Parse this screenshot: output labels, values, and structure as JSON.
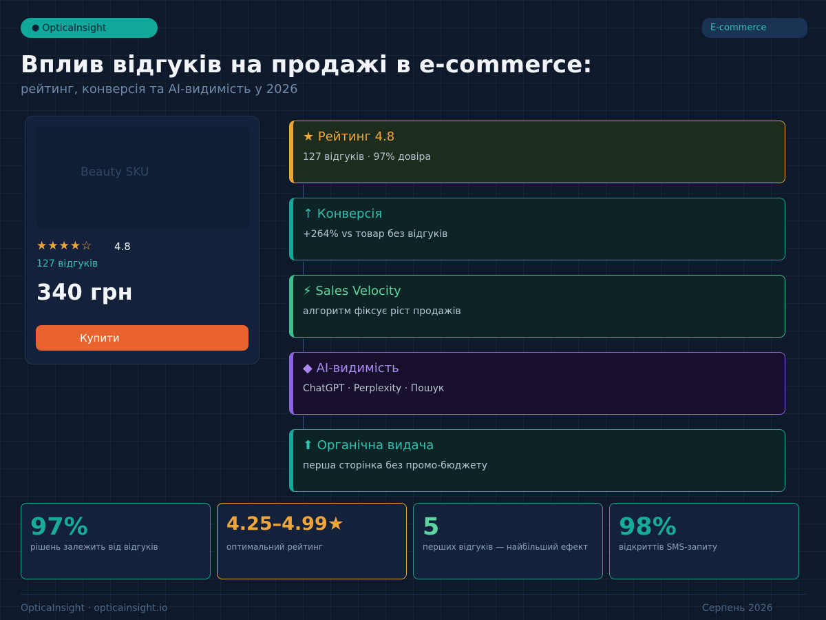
{
  "header": {
    "brand_dot": "●",
    "brand": "OpticaInsight",
    "tag": "E-commerce",
    "title": "Вплив відгуків на продажі в e-commerce:",
    "subtitle": "рейтинг, конверсія та AI-видимість у 2026"
  },
  "product": {
    "image_label": "Beauty SKU",
    "rating_stars": "★★★★☆",
    "rating_value": "4.8",
    "review_count": "127 відгуків",
    "price": "340 грн",
    "buy_label": "Купити"
  },
  "flow": {
    "steps": [
      {
        "title": "★ Рейтинг 4.8",
        "desc": "127 відгуків · 97% довіра",
        "accent": "#f0a53a"
      },
      {
        "title": "↑ Конверсія",
        "desc": "+264% vs товар без відгуків",
        "accent": "#2fc2b0"
      },
      {
        "title": "⚡ Sales Velocity",
        "desc": "алгоритм фіксує ріст продажів",
        "accent": "#5fd4a0"
      },
      {
        "title": "◆ AI-видимість",
        "desc": "ChatGPT · Perplexity · Пошук",
        "accent": "#a987f0"
      },
      {
        "title": "⬆ Органічна видача",
        "desc": "перша сторінка без промо-бюджету",
        "accent": "#2fc2b0"
      }
    ]
  },
  "stats": [
    {
      "value": "97%",
      "label": "рішень залежить від відгуків",
      "accent": "#17ab9c"
    },
    {
      "value": "4.25–4.99★",
      "label": "оптимальний рейтинг",
      "accent": "#f0a53a"
    },
    {
      "value": "5",
      "label": "перших відгуків — найбільший ефект",
      "accent": "#5fd4a0"
    },
    {
      "value": "98%",
      "label": "відкриттів SMS-запиту",
      "accent": "#17ab9c"
    }
  ],
  "footer": {
    "left": "OpticaInsight · opticainsight.io",
    "right": "Серпень 2026"
  }
}
